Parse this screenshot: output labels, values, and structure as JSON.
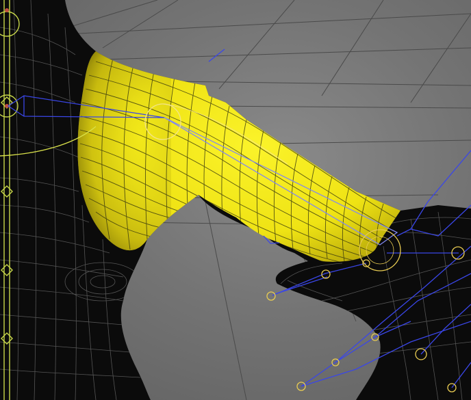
{
  "viewport": {
    "background_color": "#7a7a7a",
    "grid_color": "#4a4a4a",
    "mesh_color": "#0b0b0b",
    "wire_color": "#6a6a6a",
    "selected_color": "#f2ea12",
    "selected_wire_color": "#3a3a10",
    "joint_color": "#e9cc52",
    "bone_color": "#3a46e8",
    "spine_color": "#c9d84a",
    "icons": [
      "joint-icon",
      "bone-icon",
      "selection-ring-icon"
    ]
  }
}
